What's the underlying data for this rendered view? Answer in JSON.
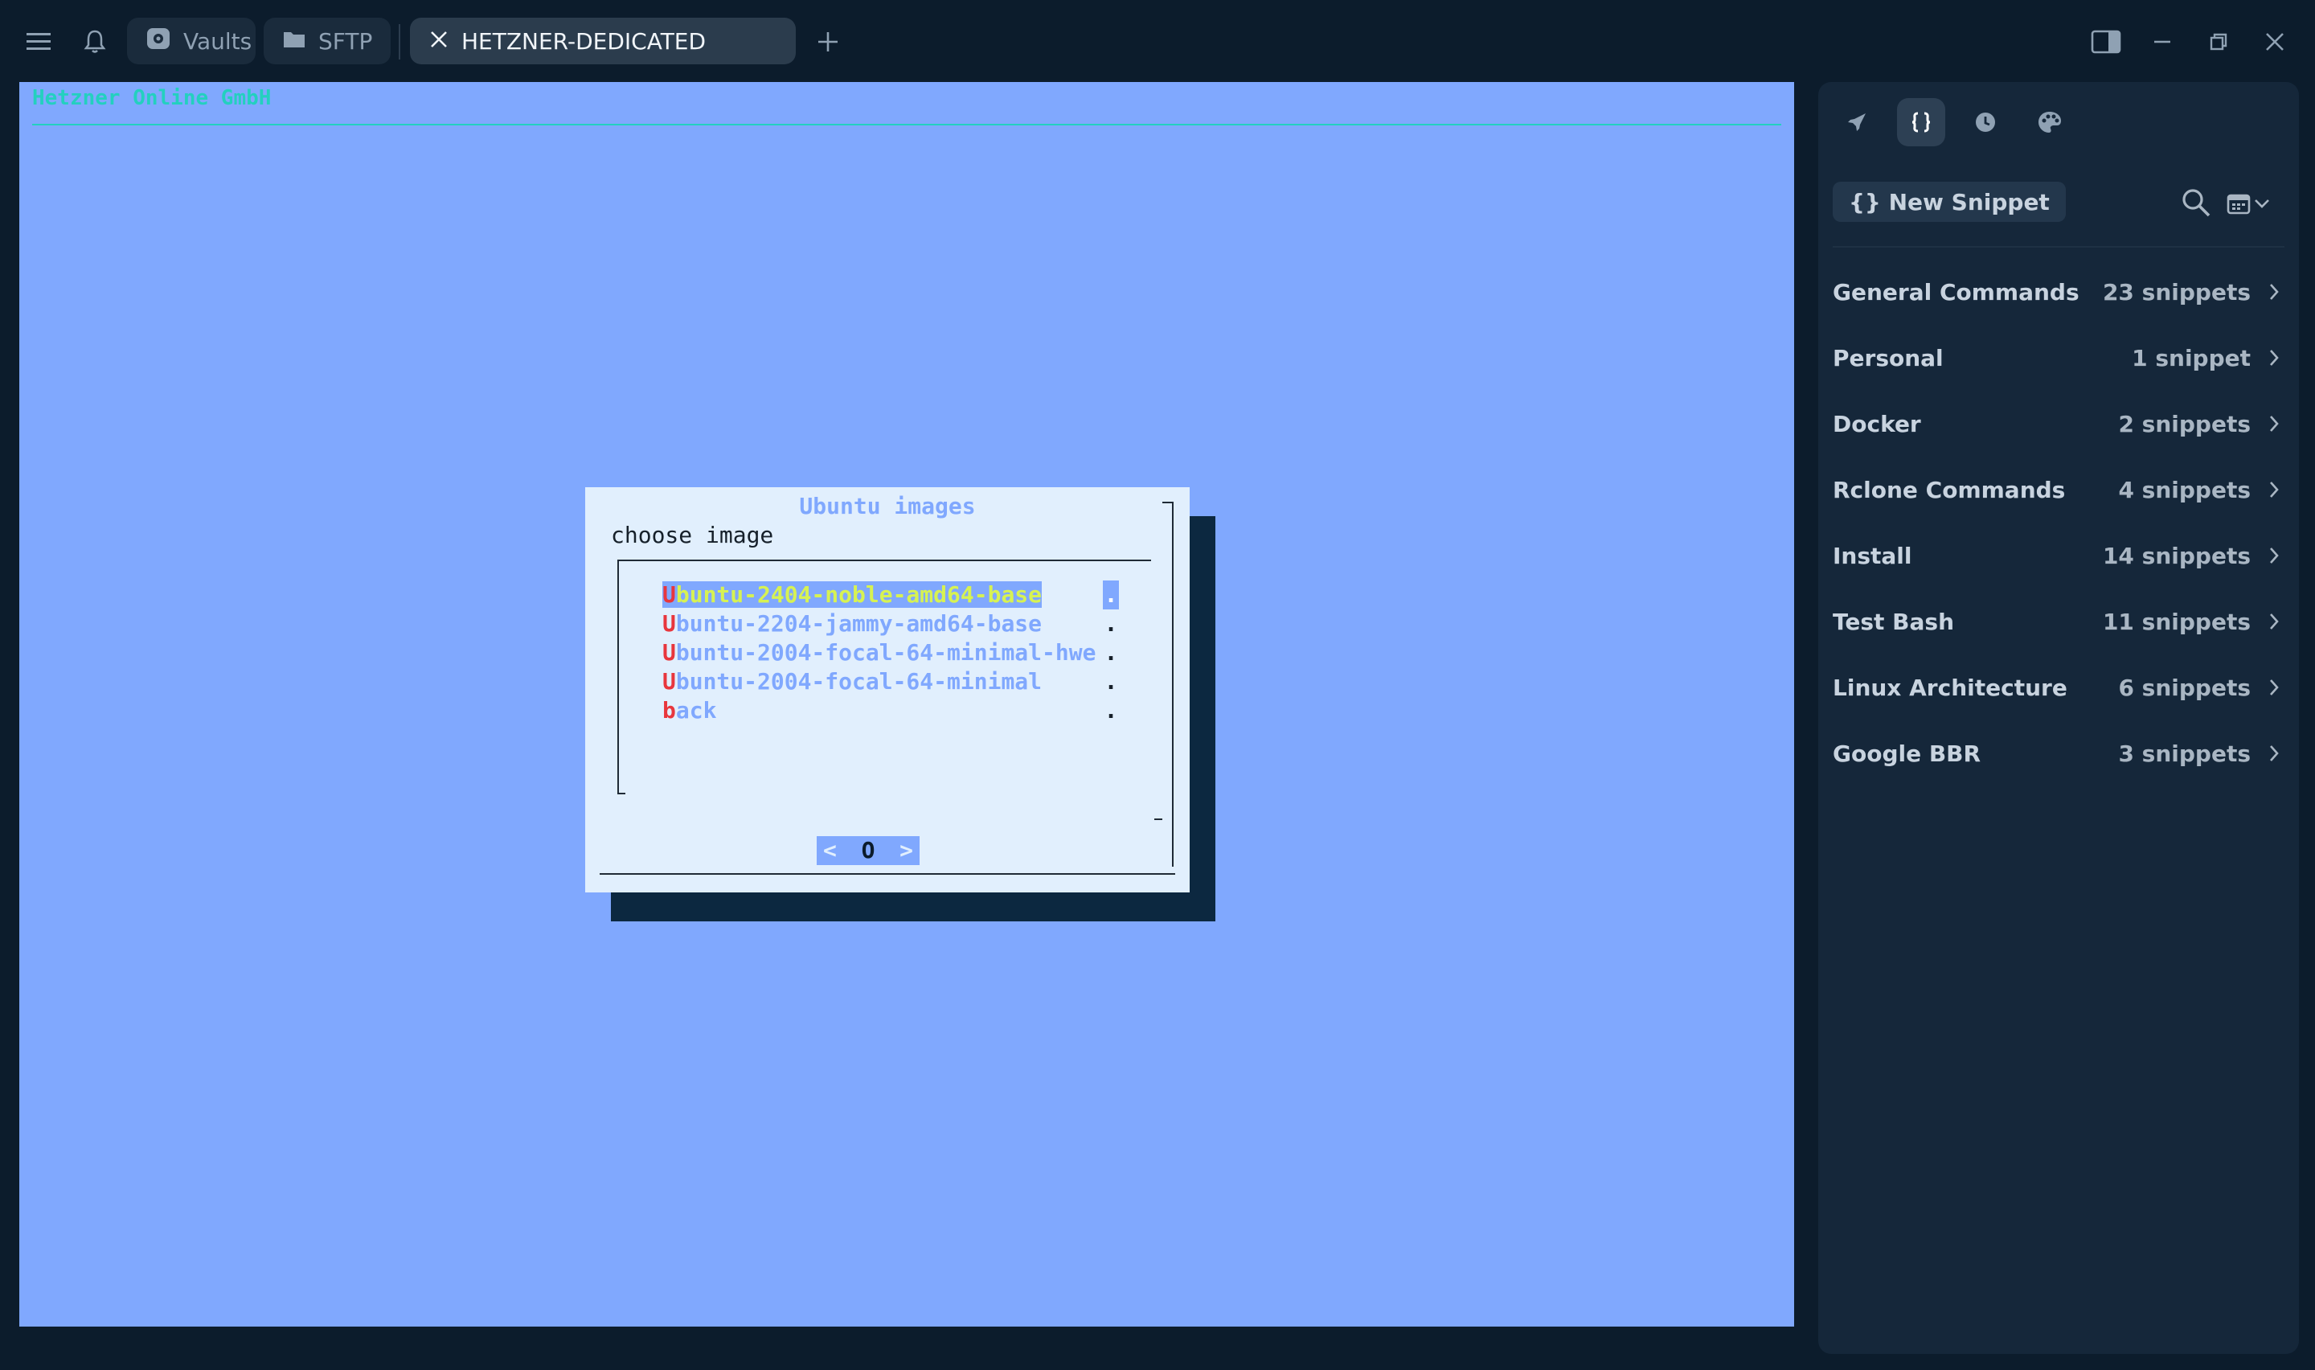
{
  "titlebar": {
    "tabs": [
      {
        "label": "Vaults",
        "icon": "vault-icon"
      },
      {
        "label": "SFTP",
        "icon": "folder-icon"
      },
      {
        "label": "HETZNER-DEDICATED",
        "icon": "close-icon",
        "active": true
      }
    ]
  },
  "terminal": {
    "header": "Hetzner Online GmbH",
    "dialog": {
      "title": "Ubuntu images",
      "prompt": "choose image",
      "items": [
        {
          "hotkey": "U",
          "rest": "buntu-2404-noble-amd64-base",
          "selected": true
        },
        {
          "hotkey": "U",
          "rest": "buntu-2204-jammy-amd64-base"
        },
        {
          "hotkey": "U",
          "rest": "buntu-2004-focal-64-minimal-hwe"
        },
        {
          "hotkey": "U",
          "rest": "buntu-2004-focal-64-minimal"
        },
        {
          "hotkey": "b",
          "rest": "ack"
        }
      ],
      "item_marker": ".",
      "ok_button": {
        "left": "<",
        "label": "O",
        "right": ">"
      }
    }
  },
  "sidebar": {
    "tools": [
      "rocket-icon",
      "snippets-icon",
      "history-icon",
      "palette-icon"
    ],
    "new_snippet_label": "{} New Snippet",
    "groups": [
      {
        "name": "General Commands",
        "count": "23 snippets"
      },
      {
        "name": "Personal",
        "count": "1 snippet"
      },
      {
        "name": "Docker",
        "count": "2 snippets"
      },
      {
        "name": "Rclone Commands",
        "count": "4 snippets"
      },
      {
        "name": "Install",
        "count": "14 snippets"
      },
      {
        "name": "Test Bash",
        "count": "11 snippets"
      },
      {
        "name": "Linux Architecture",
        "count": "6 snippets"
      },
      {
        "name": "Google BBR",
        "count": "3 snippets"
      }
    ]
  },
  "colors": {
    "terminal_bg": "#80a8fe",
    "header_green": "#23d0bf",
    "dialog_bg": "#e1effd",
    "hotkey_red": "#e8363d",
    "selected_fg": "#d7f252",
    "app_bg": "#0c1c2c",
    "sidebar_bg": "#15273a"
  }
}
